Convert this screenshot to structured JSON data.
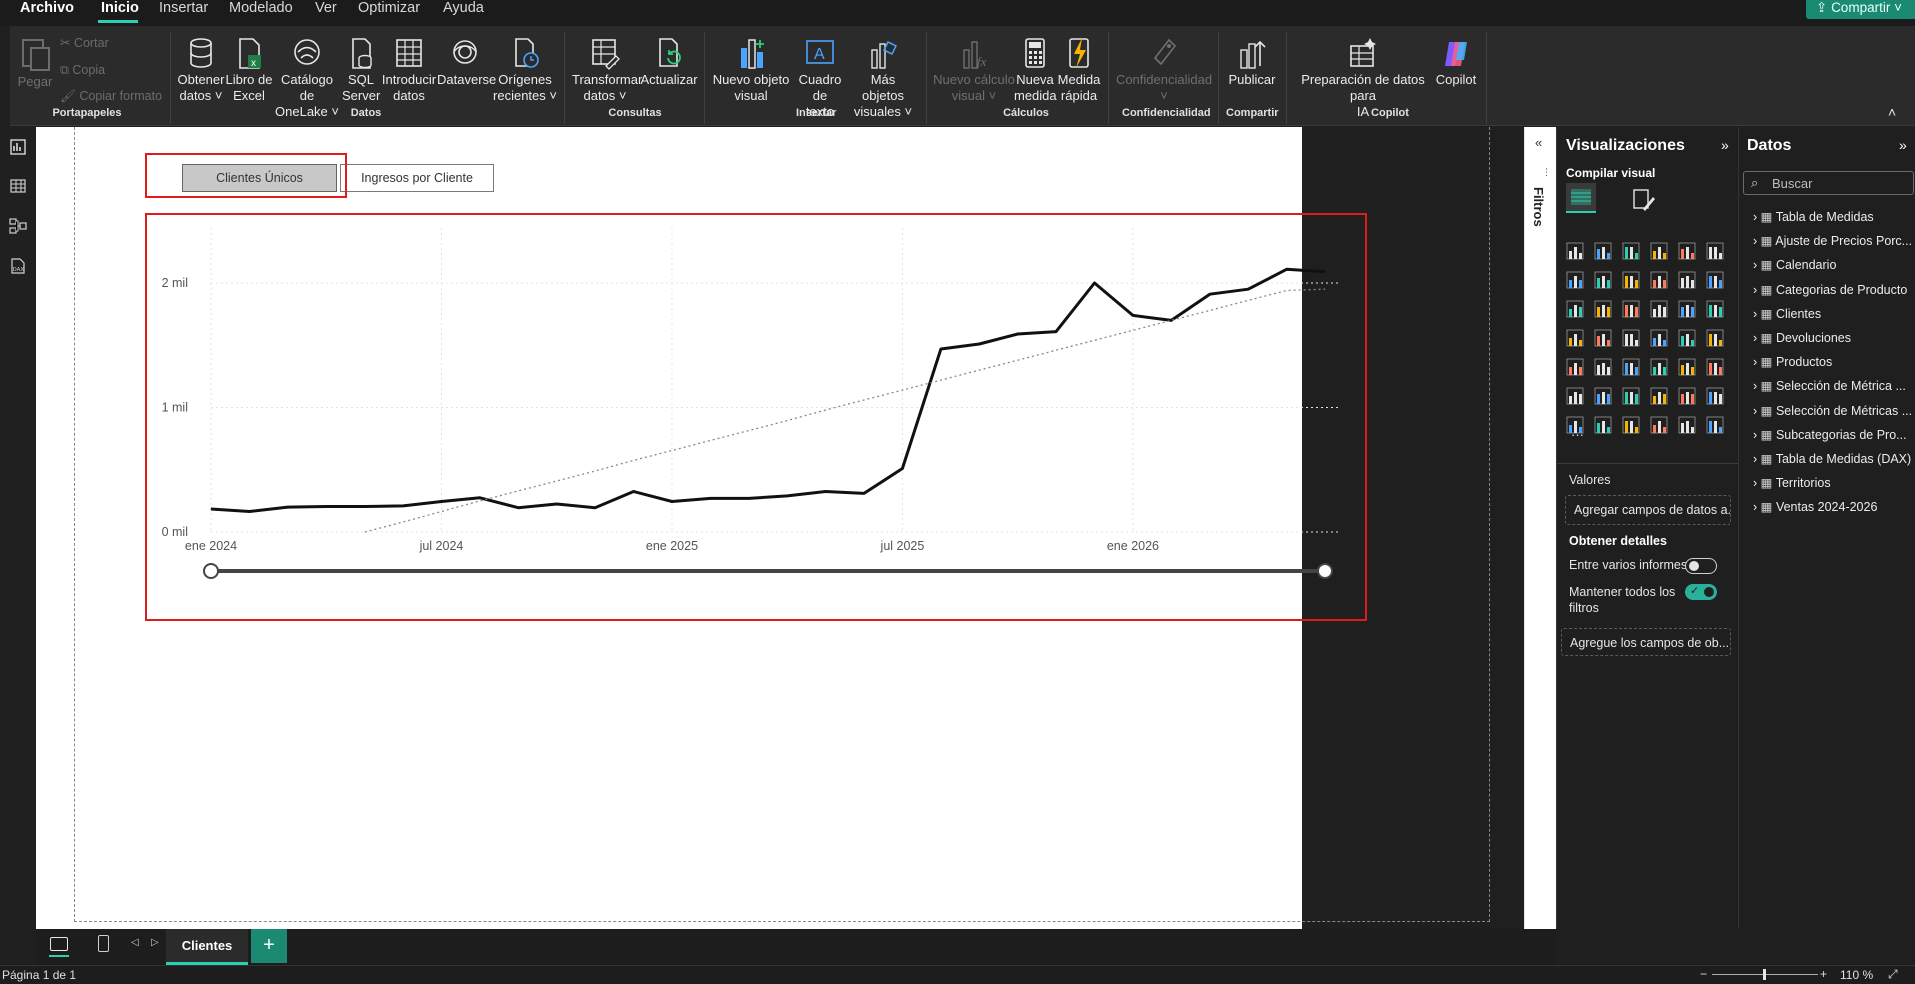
{
  "menu": {
    "file": "Archivo",
    "tabs": [
      "Inicio",
      "Insertar",
      "Modelado",
      "Ver",
      "Optimizar",
      "Ayuda"
    ],
    "active_tab": "Inicio",
    "share": "Compartir"
  },
  "ribbon": {
    "clipboard": {
      "paste": "Pegar",
      "cut": "Cortar",
      "copy": "Copia",
      "format_painter": "Copiar formato",
      "group": "Portapapeles"
    },
    "data": {
      "get_data": [
        "Obtener",
        "datos ˅"
      ],
      "excel": [
        "Libro de",
        "Excel"
      ],
      "onelake": [
        "Catálogo de",
        "OneLake ˅"
      ],
      "sql": [
        "SQL",
        "Server"
      ],
      "enter_data": [
        "Introducir",
        "datos"
      ],
      "dataverse": [
        "Dataverse",
        ""
      ],
      "recent_sources": [
        "Orígenes",
        "recientes ˅"
      ],
      "group": "Datos"
    },
    "queries": {
      "transform": [
        "Transformar",
        "datos ˅"
      ],
      "refresh": [
        "Actualizar",
        ""
      ],
      "group": "Consultas"
    },
    "insert": {
      "new_visual": [
        "Nuevo objeto",
        "visual"
      ],
      "text_box": [
        "Cuadro de",
        "texto"
      ],
      "more_visuals": [
        "Más objetos",
        "visuales ˅"
      ],
      "group": "Insertar"
    },
    "calculations": {
      "new_visual_calc": [
        "Nuevo cálculo",
        "visual ˅"
      ],
      "new_measure": [
        "Nueva",
        "medida"
      ],
      "quick_measure": [
        "Medida",
        "rápida"
      ],
      "group": "Cálculos"
    },
    "sensitivity": {
      "label": [
        "Confidencialidad",
        "˅"
      ],
      "group": "Confidencialidad"
    },
    "share": {
      "publish": "Publicar",
      "group": "Compartir"
    },
    "copilot": {
      "prep": [
        "Preparación de datos para",
        "IA"
      ],
      "copilot": "Copilot",
      "group": "Copilot"
    }
  },
  "slicer": {
    "buttons": [
      "Clientes Únicos",
      "Ingresos por Cliente"
    ],
    "selected": "Clientes Únicos"
  },
  "chart_data": {
    "type": "line",
    "title": "",
    "xlabel": "",
    "ylabel": "",
    "x_ticks": [
      "ene 2024",
      "jul 2024",
      "ene 2025",
      "jul 2025",
      "ene 2026"
    ],
    "y_ticks": [
      "0 mil",
      "1 mil",
      "2 mil"
    ],
    "ylim": [
      0,
      2000
    ],
    "x": [
      "2024-01",
      "2024-02",
      "2024-03",
      "2024-04",
      "2024-05",
      "2024-06",
      "2024-07",
      "2024-08",
      "2024-09",
      "2024-10",
      "2024-11",
      "2024-12",
      "2025-01",
      "2025-02",
      "2025-03",
      "2025-04",
      "2025-05",
      "2025-06",
      "2025-07",
      "2025-08",
      "2025-09",
      "2025-10",
      "2025-11",
      "2025-12",
      "2026-01",
      "2026-02",
      "2026-03",
      "2026-04",
      "2026-05",
      "2026-06"
    ],
    "series": [
      {
        "values": [
          185,
          165,
          200,
          205,
          205,
          210,
          245,
          275,
          195,
          225,
          195,
          325,
          245,
          270,
          270,
          290,
          325,
          310,
          510,
          1470,
          1510,
          1590,
          1610,
          2000,
          1740,
          1700,
          1910,
          1950,
          2110,
          2090
        ],
        "style": "solid",
        "color": "#111111"
      },
      {
        "values": [
          null,
          null,
          null,
          null,
          0,
          80,
          165,
          250,
          330,
          410,
          490,
          575,
          655,
          735,
          815,
          895,
          980,
          1060,
          1140,
          1220,
          1300,
          1380,
          1460,
          1540,
          1620,
          1700,
          1780,
          1860,
          1940,
          1950
        ],
        "style": "dotted",
        "color": "#888888"
      }
    ],
    "grid": true
  },
  "filters_label": "Filtros",
  "viz_pane": {
    "title": "Visualizaciones",
    "build_visual": "Compilar visual",
    "values_label": "Valores",
    "values_placeholder": "Agregar campos de datos a...",
    "drillthrough": "Obtener detalles",
    "cross_report": "Entre varios informes",
    "keep_filters": "Mantener todos los filtros",
    "drill_placeholder": "Agregue los campos de ob..."
  },
  "data_pane": {
    "title": "Datos",
    "search_placeholder": "Buscar",
    "tables": [
      "Tabla de Medidas",
      "Ajuste de Precios Porc...",
      "Calendario",
      "Categorias de Producto",
      "Clientes",
      "Devoluciones",
      "Productos",
      "Selección de Métrica ...",
      "Selección de Métricas ...",
      "Subcategorias de Pro...",
      "Tabla de Medidas (DAX)",
      "Territorios",
      "Ventas 2024-2026"
    ]
  },
  "page_tabs": {
    "current": "Clientes"
  },
  "status": {
    "page": "Página 1 de 1",
    "zoom": "110 %"
  }
}
